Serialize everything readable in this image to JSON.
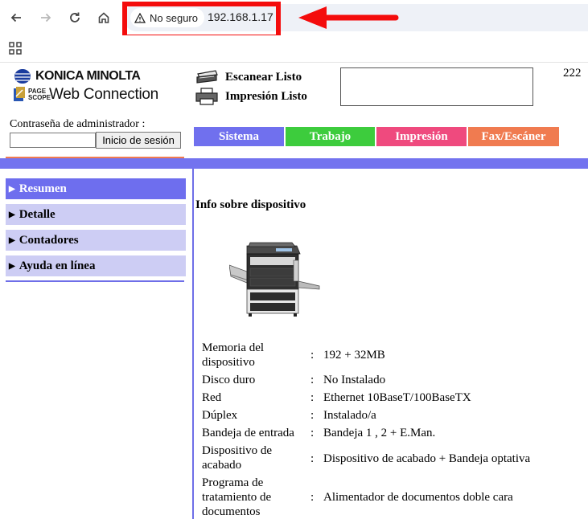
{
  "browser": {
    "security_label": "No seguro",
    "url": "192.168.1.17",
    "annotation_color": "#f40c0c",
    "icons": [
      "back-arrow-icon",
      "forward-arrow-icon",
      "reload-icon",
      "home-icon",
      "warning-triangle-icon",
      "apps-grid-icon"
    ]
  },
  "header": {
    "brand_name": "KONICA MINOLTA",
    "pagescope_text": "PAGE SCOPE",
    "product_name": "Web Connection",
    "scan_status": "Escanear Listo",
    "print_status": "Impresión Listo",
    "corner_number": "222"
  },
  "login": {
    "label": "Contraseña de administrador :",
    "password_value": "",
    "button_label": "Inicio de sesión"
  },
  "tabs": [
    {
      "label": "Sistema",
      "color": "#7070ee"
    },
    {
      "label": "Trabajo",
      "color": "#3dcc3d"
    },
    {
      "label": "Impresión",
      "color": "#ef4a7e"
    },
    {
      "label": "Fax/Escáner",
      "color": "#f07b50"
    }
  ],
  "sidebar": {
    "items": [
      {
        "label": "Resumen",
        "selected": true
      },
      {
        "label": "Detalle",
        "selected": false
      },
      {
        "label": "Contadores",
        "selected": false
      },
      {
        "label": "Ayuda en línea",
        "selected": false
      }
    ],
    "selected_color": "#6e6eee",
    "item_color": "#cdcdf4"
  },
  "main": {
    "heading": "Info sobre dispositivo",
    "rows": [
      {
        "label": "Memoria del dispositivo",
        "value": "192 + 32MB"
      },
      {
        "label": "Disco duro",
        "value": "No Instalado"
      },
      {
        "label": "Red",
        "value": "Ethernet 10BaseT/100BaseTX"
      },
      {
        "label": "Dúplex",
        "value": "Instalado/a"
      },
      {
        "label": "Bandeja de entrada",
        "value": "Bandeja 1 , 2 + E.Man."
      },
      {
        "label": "Dispositivo de acabado",
        "value": "Dispositivo de acabado + Bandeja optativa"
      },
      {
        "label": "Programa de tratamiento de documentos",
        "value": "Alimentador de documentos doble cara"
      }
    ],
    "colon": ":"
  }
}
